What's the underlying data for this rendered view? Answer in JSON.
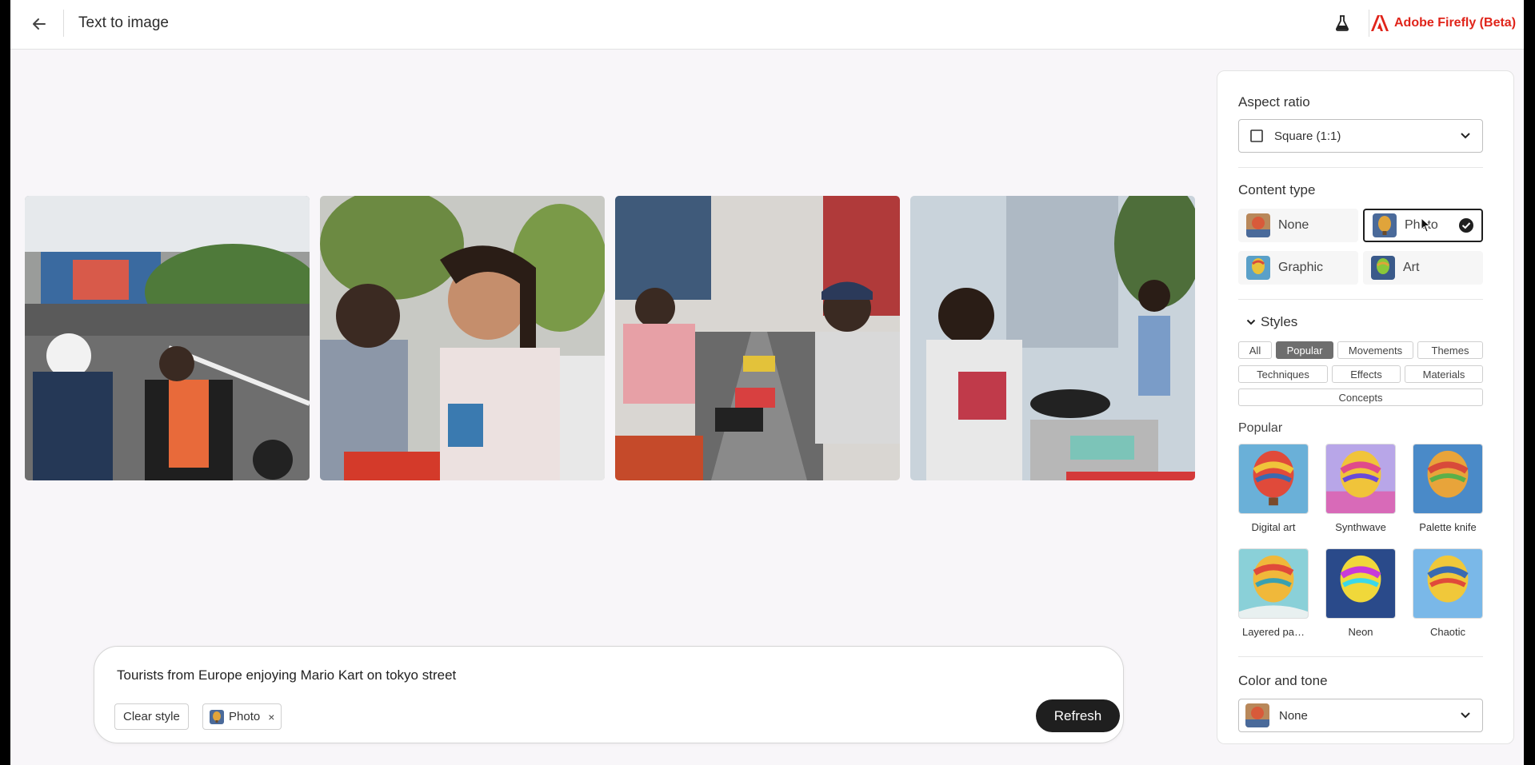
{
  "header": {
    "title": "Text to image",
    "brand": "Adobe Firefly (Beta)"
  },
  "gallery": {
    "images": [
      {
        "name": "kart-image-1"
      },
      {
        "name": "kart-image-2"
      },
      {
        "name": "kart-image-3"
      },
      {
        "name": "kart-image-4"
      }
    ]
  },
  "prompt": {
    "text": "Tourists from Europe enjoying Mario Kart on tokyo street",
    "clear_style_label": "Clear style",
    "chip_label": "Photo",
    "chip_close": "×",
    "refresh_label": "Refresh"
  },
  "panel": {
    "aspect_ratio_label": "Aspect ratio",
    "aspect_ratio_value": "Square (1:1)",
    "content_type_label": "Content type",
    "content_types": [
      {
        "label": "None",
        "selected": false
      },
      {
        "label": "Photo",
        "selected": true
      },
      {
        "label": "Graphic",
        "selected": false
      },
      {
        "label": "Art",
        "selected": false
      }
    ],
    "styles_label": "Styles",
    "style_tabs": [
      "All",
      "Popular",
      "Movements",
      "Themes",
      "Techniques",
      "Effects",
      "Materials",
      "Concepts"
    ],
    "active_style_tab": "Popular",
    "popular_label": "Popular",
    "popular_styles": [
      "Digital art",
      "Synthwave",
      "Palette knife",
      "Layered pa…",
      "Neon",
      "Chaotic"
    ],
    "color_tone_label": "Color and tone",
    "color_tone_value": "None"
  },
  "colors": {
    "brand_red": "#e0241a",
    "selected_border": "#1f1f1f",
    "active_tab_bg": "#6e6e6e"
  }
}
